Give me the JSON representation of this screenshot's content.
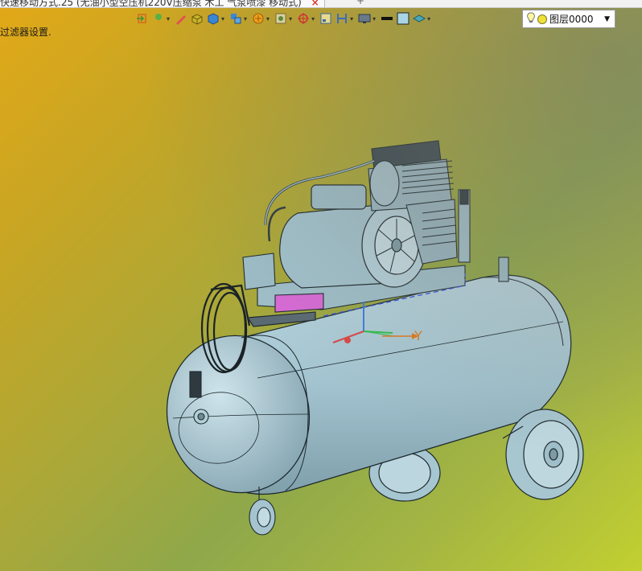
{
  "window": {
    "tab_title": "快速移动方式.25 (无油小型空压机220V压缩泵 木工 气泵喷漆 移动式)",
    "tab_close": "×",
    "tab2_label": "+"
  },
  "status": {
    "message": "过滤器设置."
  },
  "toolbar": {
    "icons": [
      "exit-icon",
      "move-icon",
      "pen-icon",
      "box-icon",
      "cube-icon",
      "component-icon",
      "filter-icon",
      "view-icon",
      "target-icon",
      "layout-icon",
      "split-icon",
      "display-icon",
      "line-icon",
      "fill-icon",
      "material-icon"
    ]
  },
  "layer": {
    "name": "图层0000"
  },
  "triad": {
    "y_label": "Y"
  },
  "colors": {
    "tank": "#9fc3cf",
    "edges": "#1e2a2e",
    "highlight": "#d86ad6",
    "triad_green": "#2fbf4a",
    "triad_red": "#d94848",
    "triad_blue": "#3d7de0",
    "triad_orange": "#e07a1c"
  }
}
